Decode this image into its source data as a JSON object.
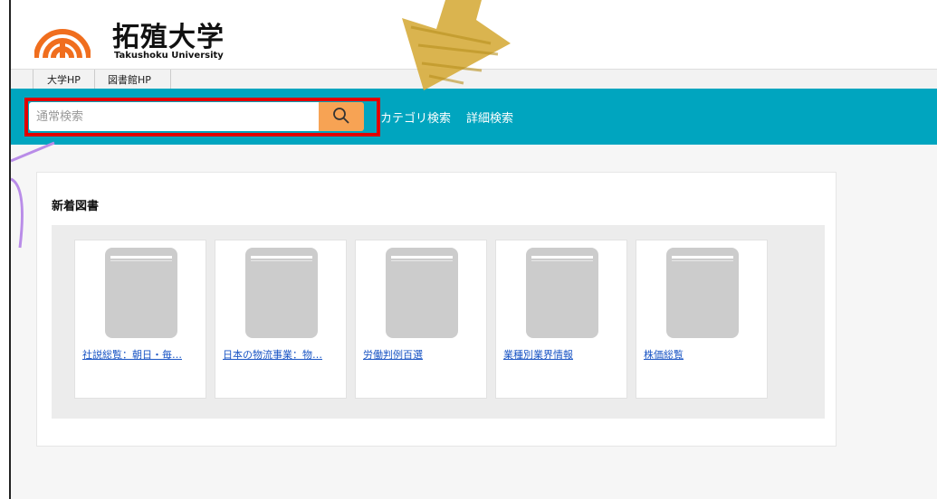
{
  "header": {
    "title": "拓殖大学",
    "subtitle": "Takushoku University"
  },
  "topnav": {
    "links": [
      "大学HP",
      "図書館HP"
    ]
  },
  "search": {
    "placeholder": "通常検索",
    "value": "",
    "category_label": "カテゴリ検索",
    "advanced_label": "詳細検索"
  },
  "new_books": {
    "title": "新着図書",
    "items": [
      {
        "title": "社説総覧：朝日・毎…"
      },
      {
        "title": "日本の物流事業：物…"
      },
      {
        "title": "労働判例百選"
      },
      {
        "title": "業種別業界情報"
      },
      {
        "title": "株価総覧"
      }
    ]
  },
  "colors": {
    "accent": "#00a5bf",
    "search_button": "#f7a354",
    "logo": "#f06e1e",
    "highlight": "#e00000",
    "link": "#1a55c4"
  },
  "icons": {
    "search": "search-icon",
    "book_placeholder": "book-icon"
  }
}
